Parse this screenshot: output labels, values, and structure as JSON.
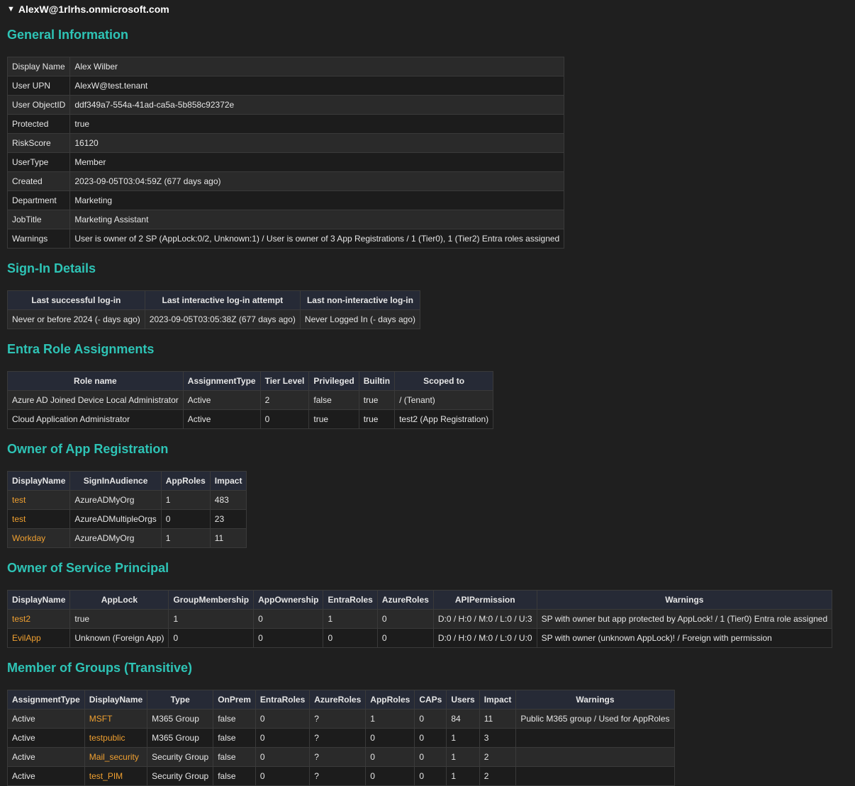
{
  "summary": {
    "user": "AlexW@1rlrhs.onmicrosoft.com"
  },
  "sections": {
    "general": "General Information",
    "signin": "Sign-In Details",
    "entra": "Entra Role Assignments",
    "appreg": "Owner of App Registration",
    "sp": "Owner of Service Principal",
    "groups": "Member of Groups (Transitive)"
  },
  "general": [
    {
      "k": "Display Name",
      "v": "Alex Wilber"
    },
    {
      "k": "User UPN",
      "v": "AlexW@test.tenant"
    },
    {
      "k": "User ObjectID",
      "v": "ddf349a7-554a-41ad-ca5a-5b858c92372e"
    },
    {
      "k": "Protected",
      "v": "true"
    },
    {
      "k": "RiskScore",
      "v": "16120"
    },
    {
      "k": "UserType",
      "v": "Member"
    },
    {
      "k": "Created",
      "v": "2023-09-05T03:04:59Z (677 days ago)"
    },
    {
      "k": "Department",
      "v": "Marketing"
    },
    {
      "k": "JobTitle",
      "v": "Marketing Assistant"
    },
    {
      "k": "Warnings",
      "v": "User is owner of 2 SP (AppLock:0/2, Unknown:1) / User is owner of 3 App Registrations / 1 (Tier0), 1 (Tier2) Entra roles assigned"
    }
  ],
  "signin": {
    "headers": [
      "Last successful log-in",
      "Last interactive log-in attempt",
      "Last non-interactive log-in"
    ],
    "rows": [
      [
        "Never or before 2024 (- days ago)",
        "2023-09-05T03:05:38Z (677 days ago)",
        "Never Logged In (- days ago)"
      ]
    ]
  },
  "entra": {
    "headers": [
      "Role name",
      "AssignmentType",
      "Tier Level",
      "Privileged",
      "Builtin",
      "Scoped to"
    ],
    "rows": [
      [
        "Azure AD Joined Device Local Administrator",
        "Active",
        "2",
        "false",
        "true",
        "/ (Tenant)"
      ],
      [
        "Cloud Application Administrator",
        "Active",
        "0",
        "true",
        "true",
        "test2 (App Registration)"
      ]
    ]
  },
  "appreg": {
    "headers": [
      "DisplayName",
      "SignInAudience",
      "AppRoles",
      "Impact"
    ],
    "rows": [
      [
        "test",
        "AzureADMyOrg",
        "1",
        "483"
      ],
      [
        "test",
        "AzureADMultipleOrgs",
        "0",
        "23"
      ],
      [
        "Workday",
        "AzureADMyOrg",
        "1",
        "11"
      ]
    ]
  },
  "sp": {
    "headers": [
      "DisplayName",
      "AppLock",
      "GroupMembership",
      "AppOwnership",
      "EntraRoles",
      "AzureRoles",
      "APIPermission",
      "Warnings"
    ],
    "rows": [
      [
        "test2",
        "true",
        "1",
        "0",
        "1",
        "0",
        "D:0 / H:0 / M:0 / L:0 / U:3",
        "SP with owner but app protected by AppLock! / 1 (Tier0) Entra role assigned"
      ],
      [
        "EvilApp",
        "Unknown (Foreign App)",
        "0",
        "0",
        "0",
        "0",
        "D:0 / H:0 / M:0 / L:0 / U:0",
        "SP with owner (unknown AppLock)! / Foreign with permission"
      ]
    ]
  },
  "groups": {
    "headers": [
      "AssignmentType",
      "DisplayName",
      "Type",
      "OnPrem",
      "EntraRoles",
      "AzureRoles",
      "AppRoles",
      "CAPs",
      "Users",
      "Impact",
      "Warnings"
    ],
    "rows": [
      [
        "Active",
        "MSFT",
        "M365 Group",
        "false",
        "0",
        "?",
        "1",
        "0",
        "84",
        "11",
        "Public M365 group / Used for AppRoles"
      ],
      [
        "Active",
        "testpublic",
        "M365 Group",
        "false",
        "0",
        "?",
        "0",
        "0",
        "1",
        "3",
        ""
      ],
      [
        "Active",
        "Mail_security",
        "Security Group",
        "false",
        "0",
        "?",
        "0",
        "0",
        "1",
        "2",
        ""
      ],
      [
        "Active",
        "test_PIM",
        "Security Group",
        "false",
        "0",
        "?",
        "0",
        "0",
        "1",
        "2",
        ""
      ]
    ]
  }
}
